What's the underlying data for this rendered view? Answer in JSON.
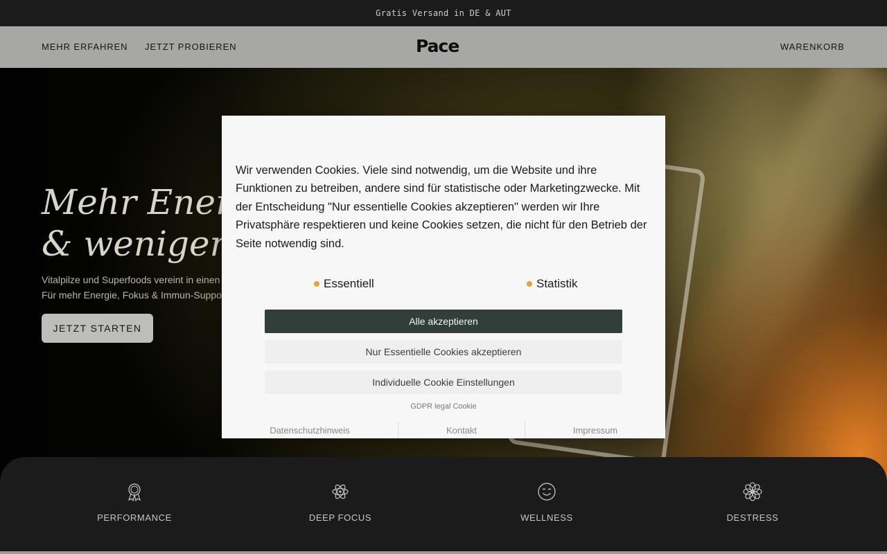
{
  "announcement": "Gratis Versand in DE & AUT",
  "nav": {
    "left_links": [
      "MEHR ERFAHREN",
      "JETZT PROBIEREN"
    ],
    "logo": "Pace",
    "cart": "WARENKORB"
  },
  "hero": {
    "title_line1": "Mehr Energi",
    "title_line2": "& weniger St",
    "subtitle_line1": "Vitalpilze und Superfoods vereint in einen",
    "subtitle_line2": "Für mehr Energie, Fokus & Immun-Suppo",
    "cta": "JETZT STARTEN"
  },
  "cookie_modal": {
    "text": "Wir verwenden Cookies. Viele sind notwendig, um die Website und ihre Funktionen zu betreiben, andere sind für statistische oder Marketingzwecke. Mit der Entscheidung \"Nur essentielle Cookies akzeptieren\" werden wir Ihre Privatsphäre respektieren und keine Cookies setzen, die nicht für den Betrieb der Seite notwendig sind.",
    "categories": [
      "Essentiell",
      "Statistik"
    ],
    "accept_all": "Alle akzeptieren",
    "accept_essential": "Nur Essentielle Cookies akzeptieren",
    "individual_settings": "Individuelle Cookie Einstellungen",
    "gdpr_label": "GDPR legal Cookie",
    "footer_links": [
      "Datenschutzhinweis",
      "Kontakt",
      "Impressum"
    ],
    "dot_color": "#f0a030",
    "primary_color": "#323e3a"
  },
  "features": [
    {
      "label": "PERFORMANCE",
      "icon": "award-ribbon-icon"
    },
    {
      "label": "DEEP FOCUS",
      "icon": "atom-icon"
    },
    {
      "label": "WELLNESS",
      "icon": "smiley-face-icon"
    },
    {
      "label": "DESTRESS",
      "icon": "flower-icon"
    }
  ]
}
